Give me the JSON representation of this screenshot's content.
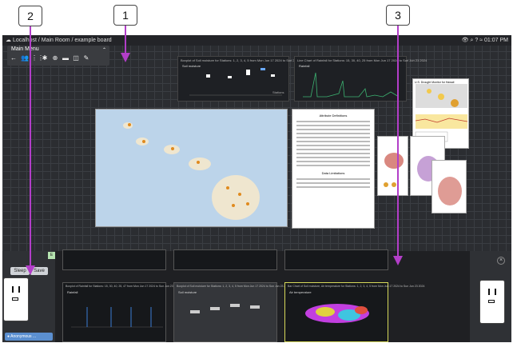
{
  "topbar": {
    "breadcrumb": "Localhost / Main Room / example board",
    "clock": "01:07 PM"
  },
  "menu": {
    "title": "Main Menu",
    "icons": [
      "arrow-left-icon",
      "users-icon",
      "apps-icon",
      "plugin-icon",
      "target-icon",
      "folder-icon",
      "map-icon",
      "pencil-icon"
    ]
  },
  "cards": {
    "bar_chart": {
      "title": "Boxplot of Soil moisture for Stations: 1, 2, 3, 4, 5 from Mon Jun 17 2024 to Sun Jun 23 2024",
      "sub": "Soil moisture",
      "axis_label": "Stations"
    },
    "rain_chart": {
      "title": "Line Chart of Rainfall for Stations: 15, 30, 40, 25 from Mon Jun 17 2024 to Sun Jun 23 2024",
      "sub": "Rainfall"
    },
    "drought": {
      "title": "U.S. Drought Monitor for Hawaii"
    },
    "doc": {
      "heading": "Attribute Definitions",
      "heading2": "Data Limitations"
    }
  },
  "left_panel": {
    "sleep": "Sleep",
    "save": "Save",
    "badge": "E",
    "user": "Anonymous ..."
  },
  "thumbs": [
    {
      "title": "Boxplot of Rainfall for Stations: 15, 30, 40, 25, 47 from Mon Jun 17 2024 to Sun Jun 23 2024",
      "sub": "Rainfall"
    },
    {
      "title": "Boxplot of Soil moisture for Stations: 1, 2, 3, 4, 5 from Mon Jun 17 2024 to Sun Jun 23 2024",
      "sub": "Soil moisture"
    },
    {
      "title": "Bar Chart of Soil moisture, Air temperature for Stations: 1, 2, 3, 4, 5 from Mon Jun 17 2024 to Sun Jun 23 2024",
      "sub": "Air temperature"
    }
  ],
  "callouts": [
    "1",
    "2",
    "3"
  ],
  "colors": {
    "arrow": "#b23ec8",
    "selected_border": "#d7d95a"
  }
}
